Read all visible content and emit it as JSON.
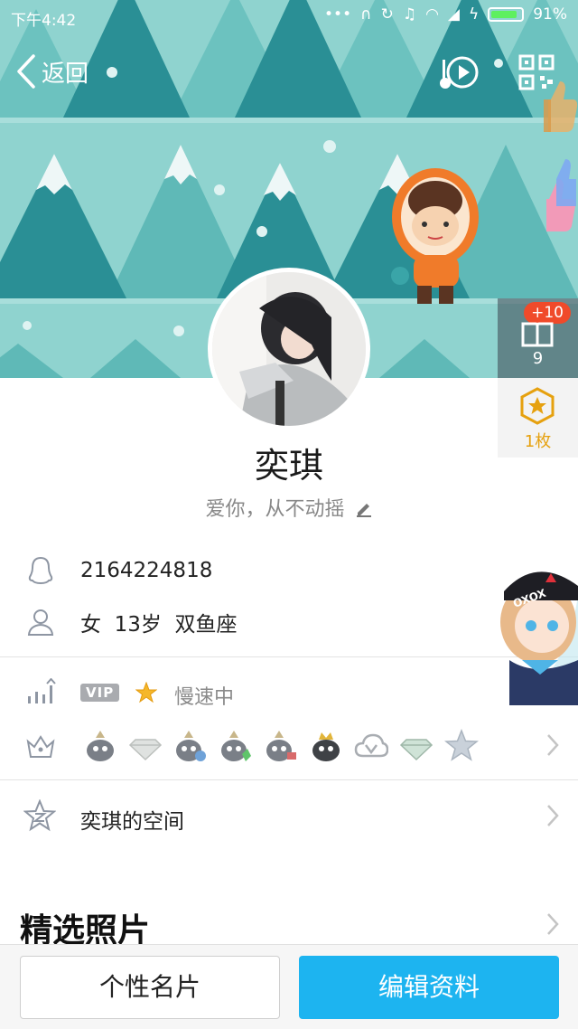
{
  "status_bar": {
    "time": "下午4:42",
    "battery": "91%",
    "icons": [
      "more-icon",
      "headset-icon",
      "sync-icon",
      "mute-bell-icon",
      "wifi-icon",
      "signal-icon",
      "charging-icon",
      "battery-icon"
    ]
  },
  "nav": {
    "back_label": "返回",
    "music_icon": "music-play-icon",
    "qr_icon": "qr-code-icon"
  },
  "visitors": {
    "badge": "+10",
    "count": "9"
  },
  "medals": {
    "count": "1枚"
  },
  "profile": {
    "nickname": "奕琪",
    "signature": "爱你，从不动摇"
  },
  "info": {
    "qq_number": "2164224818",
    "gender_age_sign": "女  13岁  双鱼座"
  },
  "vip": {
    "tag": "VIP",
    "status": "慢速中"
  },
  "badges": [
    "penguin-crown-icon",
    "diamond-icon",
    "penguin-blue-icon",
    "penguin-green-icon",
    "penguin-red-icon",
    "penguin-gold-crown-icon",
    "cloud-v-icon",
    "diamond-green-icon",
    "star-icon"
  ],
  "space": {
    "label": "奕琪的空间"
  },
  "photos": {
    "title": "精选照片"
  },
  "buttons": {
    "card": "个性名片",
    "edit": "编辑资料"
  },
  "colors": {
    "banner_bg": "#8fd3cf",
    "tree_dark": "#2a8f95",
    "tree_light": "#5fb9b7",
    "accent_blue": "#1db4f0",
    "badge_red": "#f04a2a",
    "medal_gold": "#e6a10f"
  }
}
